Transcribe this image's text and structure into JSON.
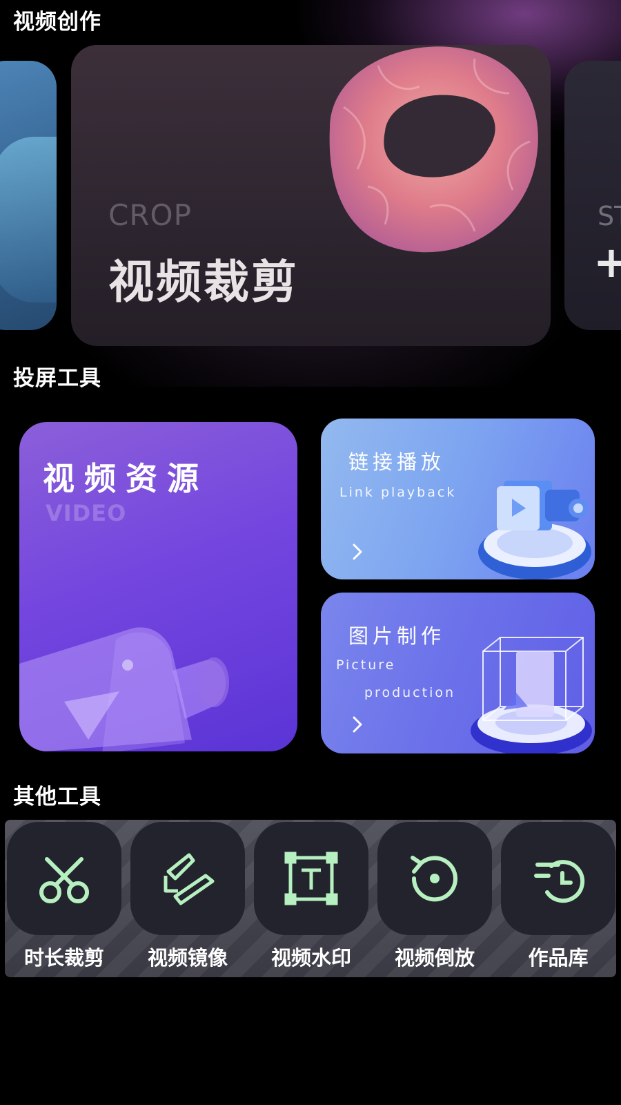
{
  "sections": {
    "video_creation": "视频创作",
    "projection_tools": "投屏工具",
    "other_tools": "其他工具"
  },
  "carousel": {
    "main": {
      "label": "CROP",
      "title": "视频裁剪"
    },
    "right_partial": {
      "label": "ST",
      "title": "+"
    }
  },
  "projection": {
    "video_resource": {
      "title": "视频资源",
      "subtitle": "VIDEO"
    },
    "link_playback": {
      "title": "链接播放",
      "subtitle": "Link playback"
    },
    "picture_production": {
      "title": "图片制作",
      "subtitle_line1": "Picture",
      "subtitle_line2": "production"
    }
  },
  "tools": [
    {
      "label": "时长裁剪",
      "icon": "scissors-icon"
    },
    {
      "label": "视频镜像",
      "icon": "mirror-icon"
    },
    {
      "label": "视频水印",
      "icon": "watermark-icon"
    },
    {
      "label": "视频倒放",
      "icon": "reverse-icon"
    },
    {
      "label": "作品库",
      "icon": "history-icon"
    }
  ],
  "colors": {
    "background": "#000000",
    "icon_accent": "#b7f0c0",
    "video_card": "#7446df",
    "link_card": "#7ea6f0",
    "picture_card": "#6c72ea"
  }
}
